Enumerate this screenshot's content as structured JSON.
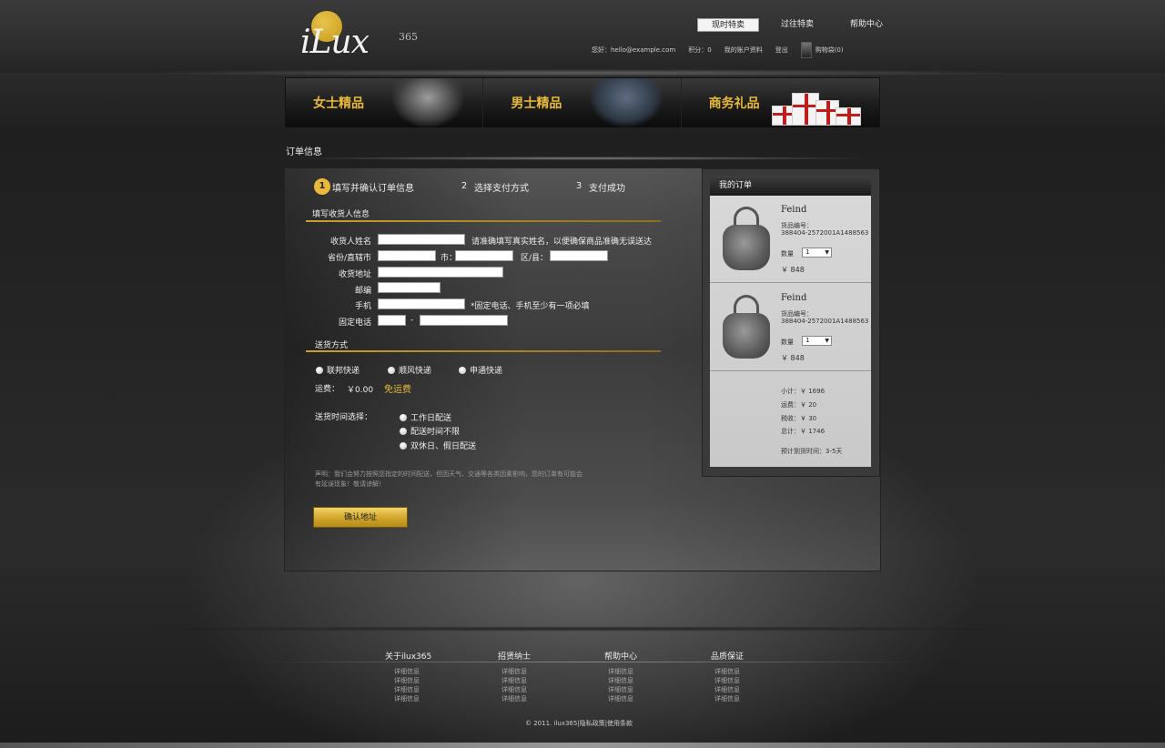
{
  "logo": {
    "text": "iLux",
    "sup": "365"
  },
  "top_nav": [
    {
      "label": "现时特卖",
      "active": true
    },
    {
      "label": "过往特卖",
      "active": false
    },
    {
      "label": "帮助中心",
      "active": false
    }
  ],
  "user_bar": {
    "greeting": "您好：hello@example.com",
    "points": "积分：0",
    "account": "我的账户资料",
    "logout": "登出",
    "cart": "购物袋(0)"
  },
  "categories": [
    {
      "label": "女士精品"
    },
    {
      "label": "男士精品"
    },
    {
      "label": "商务礼品"
    }
  ],
  "section_title": "订单信息",
  "steps": [
    {
      "num": "1",
      "label": "填写并确认订单信息"
    },
    {
      "num": "2",
      "label": "选择支付方式"
    },
    {
      "num": "3",
      "label": "支付成功"
    }
  ],
  "receiver": {
    "title": "填写收货人信息",
    "name_label": "收货人姓名",
    "name_hint": "请准确填写真实姓名，以便确保商品准确无误送达",
    "province_label": "省份/直辖市",
    "city_label": "市：",
    "district_label": "区/县：",
    "address_label": "收货地址",
    "zip_label": "邮编",
    "mobile_label": "手机",
    "mobile_hint": "*固定电话、手机至少有一项必填",
    "phone_label": "固定电话",
    "phone_sep": "-"
  },
  "delivery": {
    "title": "送货方式",
    "options": [
      "联邦快递",
      "顺风快递",
      "申通快递"
    ],
    "fee_label": "运费：",
    "fee_value": "￥0.00",
    "free_label": "免运费",
    "time_label": "送货时间选择：",
    "time_options": [
      "工作日配送",
      "配送时间不限",
      "双休日、假日配送"
    ]
  },
  "notice": "声明：我们会努力按照您指定的时间配送，但因天气、交通等各类因素影响，您的订单有可能会有延误现象！敬请谅解！",
  "confirm_label": "确认地址",
  "order": {
    "title": "我的订单",
    "products": [
      {
        "name": "Feind",
        "code_label": "货品编号：",
        "code": "388404-2572001A1488563",
        "qty_label": "数量",
        "qty": "1",
        "price": "￥ 848"
      },
      {
        "name": "Feind",
        "code_label": "货品编号：",
        "code": "388404-2572001A1488563",
        "qty_label": "数量",
        "qty": "1",
        "price": "￥ 848"
      }
    ],
    "subtotal": "小计：￥ 1696",
    "shipping": "运费：￥ 20",
    "tax": "税收：￥ 30",
    "total": "总计：￥ 1746",
    "eta": "预计到货时间：3-5天"
  },
  "footer": {
    "columns": [
      {
        "title": "关于ilux365",
        "items": [
          "详细信息",
          "详细信息",
          "详细信息",
          "详细信息"
        ]
      },
      {
        "title": "招贤纳士",
        "items": [
          "详细信息",
          "详细信息",
          "详细信息",
          "详细信息"
        ]
      },
      {
        "title": "帮助中心",
        "items": [
          "详细信息",
          "详细信息",
          "详细信息",
          "详细信息"
        ]
      },
      {
        "title": "品质保证",
        "items": [
          "详细信息",
          "详细信息",
          "详细信息",
          "详细信息"
        ]
      }
    ],
    "copyright": "© 2011. ilux365",
    "privacy": "隐私政策",
    "terms": "使用条款"
  }
}
